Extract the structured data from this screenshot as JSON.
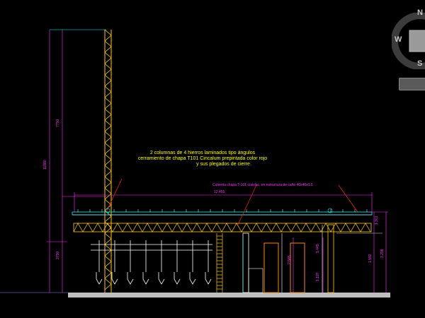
{
  "notes": {
    "line1": "2 columnas de 4 hierros laminados tipo ángulos",
    "line2": "cerramiento de chapa T101 Cincalum prepintada color rojo",
    "line3": "y sus plegados de cierre.",
    "cover_note": "Cubierta chapa T-101 c/aislac. en estructura de caño 40x40x1.5"
  },
  "dimensions": {
    "total_height": "11880",
    "upper_height": "7750",
    "lower_left": "3750",
    "span": "12.455",
    "right_a": "2.585",
    "right_b": "1.449",
    "right_c": "1.197",
    "right_d": "1.592",
    "right_e": "3.298",
    "right_f": "1.301"
  },
  "viewcube": {
    "north": "N",
    "west": "W",
    "south": "S"
  },
  "colors": {
    "background": "#000000",
    "tower": "#ffcc00",
    "dimension_cyan": "#00ffff",
    "dimension_magenta": "#ff33ff",
    "leader_red": "#ff2020",
    "ground": "#bfbfbf",
    "door_orange": "#ff8800",
    "truss_white": "#e0e0e0"
  }
}
